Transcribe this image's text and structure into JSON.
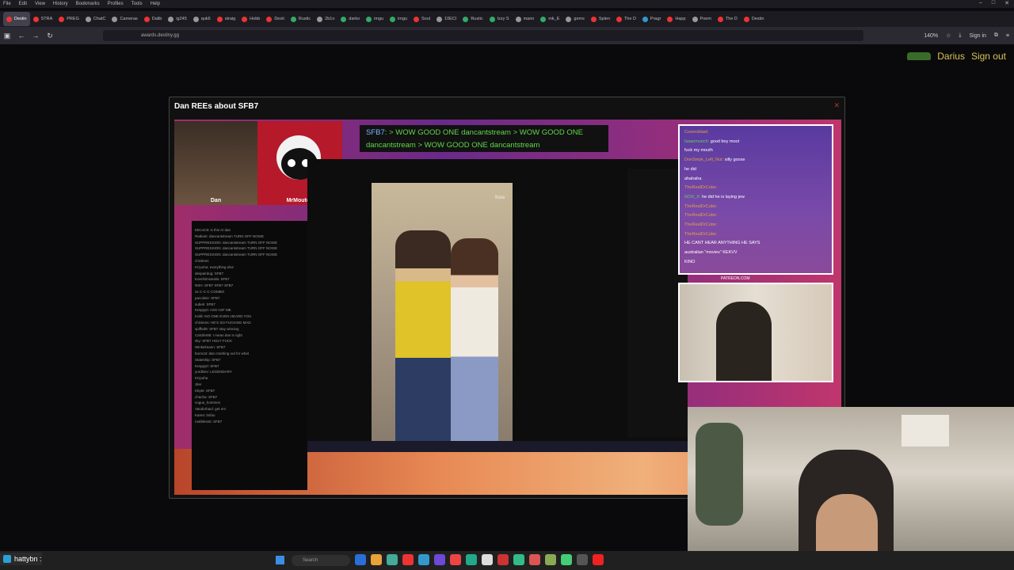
{
  "menubar": {
    "items": [
      "File",
      "Edit",
      "View",
      "History",
      "Bookmarks",
      "Profiles",
      "Tools",
      "Help"
    ]
  },
  "tabs": [
    {
      "label": "Destin",
      "color": "#e33"
    },
    {
      "label": "STRA",
      "color": "#e33"
    },
    {
      "label": "PREG",
      "color": "#e33"
    },
    {
      "label": "ChatC",
      "color": "#999"
    },
    {
      "label": "Cameras",
      "color": "#999"
    },
    {
      "label": "Dalib",
      "color": "#e33"
    },
    {
      "label": "ig245",
      "color": "#999"
    },
    {
      "label": "quk6",
      "color": "#999"
    },
    {
      "label": "straig",
      "color": "#e33"
    },
    {
      "label": "Hobb",
      "color": "#e33"
    },
    {
      "label": "Desti",
      "color": "#e33"
    },
    {
      "label": "Rustic",
      "color": "#3a6"
    },
    {
      "label": "2b1o",
      "color": "#999"
    },
    {
      "label": "darko",
      "color": "#3a6"
    },
    {
      "label": "imgu",
      "color": "#3a6"
    },
    {
      "label": "imgu",
      "color": "#3a6"
    },
    {
      "label": "Soul",
      "color": "#e33"
    },
    {
      "label": "10ECI",
      "color": "#999"
    },
    {
      "label": "Rustic",
      "color": "#3a6"
    },
    {
      "label": "Izzy S",
      "color": "#3a6"
    },
    {
      "label": "mann",
      "color": "#999"
    },
    {
      "label": "mk_E",
      "color": "#3a6"
    },
    {
      "label": "gems",
      "color": "#999"
    },
    {
      "label": "Splen",
      "color": "#e33"
    },
    {
      "label": "The D",
      "color": "#e33"
    },
    {
      "label": "Pragr",
      "color": "#39c"
    },
    {
      "label": "Happ",
      "color": "#e33"
    },
    {
      "label": "Poem",
      "color": "#999"
    },
    {
      "label": "The D",
      "color": "#e33"
    },
    {
      "label": "Destin",
      "color": "#e33"
    }
  ],
  "nav": {
    "url": "awards.destiny.gg",
    "zoom": "140%",
    "sign_in": "Sign in"
  },
  "page": {
    "user_name": "Darius",
    "sign_out": "Sign out",
    "panel_title": "Dan REEs about SFB7",
    "close": "✕"
  },
  "video": {
    "cam_left_label": "Dan",
    "cam_mid_label": "MrMouton",
    "banner_prefix": "SFB7",
    "banner_text": ": > WOW GOOD ONE dancantstream > WOW GOOD ONE dancantstream > WOW GOOD ONE dancantstream",
    "sora_label": "Sora",
    "left_chat": [
      "MrComit: is this AI dan",
      "Radiant: dancantstream TURN OFF NOISE",
      "SUPPRESSION: dancantstream TURN OFF NOISE",
      "SUPPRESSION: dancantstream TURN OFF NOISE",
      "SUPPRESSION: dancantstream TURN OFF NOISE",
      "chickens",
      "KCpoha: everything else",
      "despairdog: SFB7",
      "Koenhimsanda: SFB7",
      "NSH: SFB7 SFB7 SFB7",
      "2x C-C-C-COMBO",
      "pacoitsie: SFB7",
      "subek: SFB7",
      "Kreppy0: ASS ASF ME",
      "Kolik: NO ONE EVEN HEARD YOU",
      "chickens: HE'S SO FUCKING MAD",
      "spiffed9: SFB7 stay winning",
      "Calcifer85: I mean dan is right",
      "sky: SFB7 HOLY FUCK",
      "Winkelmann: SFB7",
      "burncat: dan crashing out for what",
      "Stateship: SFB7",
      "Kreppy0: SFB7",
      "yurdDev: LEGENDARY",
      "KCpoha",
      "Jiter",
      "Kbyte: SFB7",
      "chacha: SFB7",
      "vogue_hommes",
      "Vandorhaul: get em",
      "Karen: lmfao",
      "rustbless0: SFB7"
    ],
    "right_chat": [
      {
        "user": "Cosmoblast:",
        "text": "",
        "cls": "p"
      },
      {
        "user": "Isaacmunch:",
        "text": "good boy moot",
        "cls": "u"
      },
      {
        "user": "",
        "text": "fuck my mouth",
        "cls": "u"
      },
      {
        "user": "DonSmyk_Left_Nut:",
        "text": "silly goose",
        "cls": "p"
      },
      {
        "user": "",
        "text": "he did",
        "cls": "u"
      },
      {
        "user": "",
        "text": "",
        "cls": "u"
      },
      {
        "user": "",
        "text": "ahahaha",
        "cls": "u"
      },
      {
        "user": "TheRealDrCube:",
        "text": "",
        "cls": "p"
      },
      {
        "user": "GOX_X:",
        "text": "he did he is laying jew",
        "cls": "u"
      },
      {
        "user": "TheRealDrCube:",
        "text": "",
        "cls": "p"
      },
      {
        "user": "TheRealDrCube:",
        "text": "",
        "cls": "p"
      },
      {
        "user": "TheRealDrCube:",
        "text": "",
        "cls": "p"
      },
      {
        "user": "TheRealDrCube:",
        "text": "",
        "cls": "p"
      },
      {
        "user": "",
        "text": "HE CANT HEAR ANYTHING HE SAYS",
        "cls": "u"
      },
      {
        "user": "",
        "text": "australian \"movies\" KEKVV",
        "cls": "u"
      },
      {
        "user": "",
        "text": "KINO",
        "cls": "u"
      }
    ],
    "patreon": "PATREON.COM"
  },
  "taskbar": {
    "streamer": "hattybn :",
    "search_placeholder": "Search",
    "icons": [
      "#2a6fd6",
      "#e8a23a",
      "#4a9",
      "#e33",
      "#39c",
      "#6a4ad6",
      "#e44",
      "#2a8",
      "#ddd",
      "#c33",
      "#3b8",
      "#d55",
      "#8a5",
      "#4c7",
      "#555",
      "#e22"
    ]
  }
}
